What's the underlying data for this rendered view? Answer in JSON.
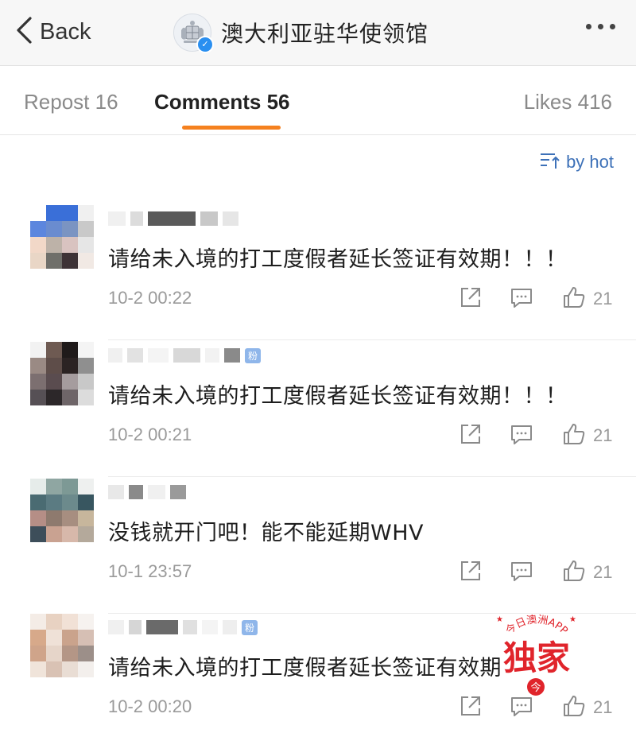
{
  "nav": {
    "back_label": "Back",
    "title": "澳大利亚驻华使领馆",
    "more_icon": "more-dots-icon"
  },
  "tabs": [
    {
      "label": "Repost 16"
    },
    {
      "label": "Comments 56",
      "active": true
    },
    {
      "label": "Likes 416"
    }
  ],
  "sort": {
    "label": "by hot",
    "icon": "sort-icon"
  },
  "comments": [
    {
      "text": "请给未入境的打工度假者延长签证有效期！！！",
      "time": "10-2 00:22",
      "likes": "21"
    },
    {
      "text": "请给未入境的打工度假者延长签证有效期！！！",
      "time": "10-2 00:21",
      "likes": "21",
      "badge": "粉"
    },
    {
      "text": "没钱就开门吧！能不能延期WHV",
      "time": "10-1 23:57",
      "likes": "21"
    },
    {
      "text": "请给未入境的打工度假者延长签证有效期",
      "time": "10-2 00:20",
      "likes": "21",
      "badge": "粉"
    }
  ],
  "watermark": {
    "arc_text": "今日澳洲APP",
    "main_text": "独家",
    "logo_char": "今"
  },
  "colors": {
    "accent": "#f5811f",
    "link": "#3d71b8",
    "verified": "#2a8ff0",
    "watermark": "#e0242b"
  }
}
